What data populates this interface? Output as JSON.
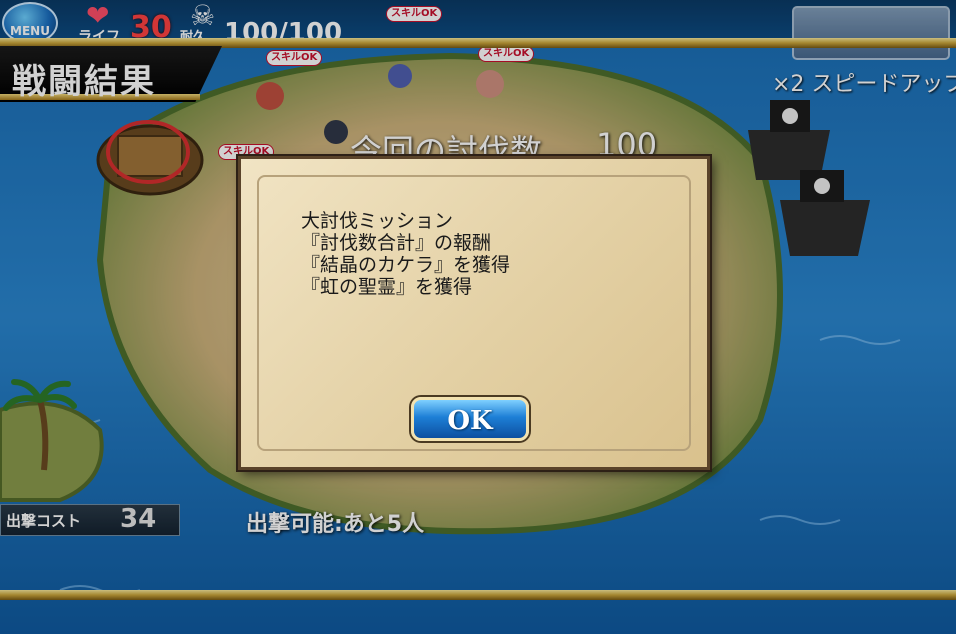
{
  "hud": {
    "menu_label": "MENU",
    "life_label": "ライフ",
    "life_value": "30",
    "durability_label": "耐久",
    "durability_value": "100/100",
    "skill_ok": "スキルOK",
    "speed_label": "×2 スピードアップ",
    "skill_ok_badges": [
      "スキルOK",
      "スキルOK",
      "スキルOK"
    ]
  },
  "title": "戦闘結果",
  "kill_label": "今回の討伐数",
  "kill_value": "100",
  "dialog": {
    "lines": [
      "大討伐ミッション",
      "『討伐数合計』の報酬",
      "『結晶のカケラ』を獲得",
      "『虹の聖霊』を獲得"
    ],
    "ok_label": "OK"
  },
  "bottom": {
    "cost_label": "出撃コスト",
    "cost_value": "34",
    "sortie_label": "出撃可能:あと5人"
  },
  "colors": {
    "sea": "#0e5fa0",
    "gold": "#c9a43a",
    "parchment": "#e3d0a4",
    "ok_blue": "#1d7fd6",
    "life_red": "#ff4242"
  },
  "icons": [
    "menu-icon",
    "heart-icon",
    "skull-icon",
    "palm-tree-icon",
    "pirate-ship-icon",
    "wooden-raft-icon"
  ]
}
